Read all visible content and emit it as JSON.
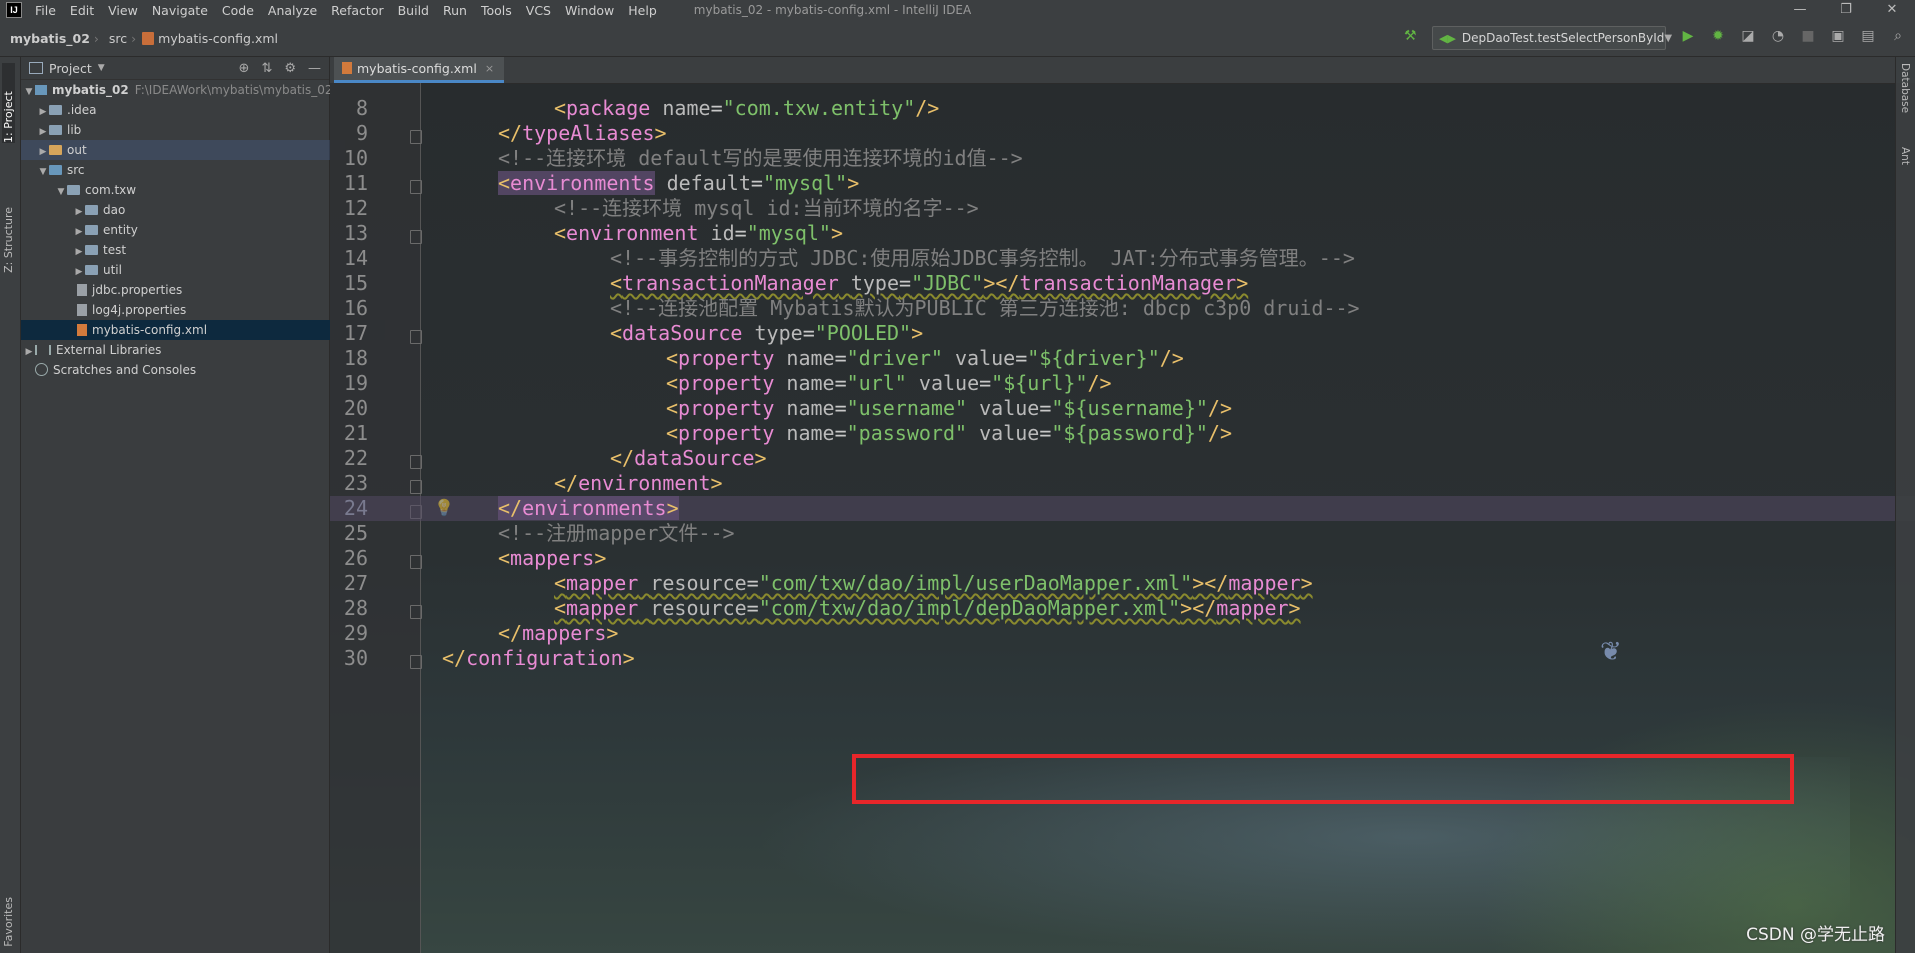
{
  "menubar": {
    "logo": "IJ",
    "items": [
      "File",
      "Edit",
      "View",
      "Navigate",
      "Code",
      "Analyze",
      "Refactor",
      "Build",
      "Run",
      "Tools",
      "VCS",
      "Window",
      "Help"
    ],
    "title": "mybatis_02 - mybatis-config.xml - IntelliJ IDEA",
    "controls": [
      "—",
      "❐",
      "✕"
    ]
  },
  "navbar": {
    "crumbs": [
      "mybatis_02",
      "src",
      "mybatis-config.xml"
    ],
    "run_config": "DepDaoTest.testSelectPersonById"
  },
  "left_strip": {
    "project_tab": "1: Project",
    "structure_tab": "Z: Structure",
    "favorites_tab": "Favorites"
  },
  "project_panel": {
    "title": "Project",
    "root": {
      "name": "mybatis_02",
      "path": "F:\\IDEAWork\\mybatis\\mybatis_02"
    },
    "items": [
      {
        "label": ".idea"
      },
      {
        "label": "lib"
      },
      {
        "label": "out"
      },
      {
        "label": "src"
      },
      {
        "label": "com.txw"
      },
      {
        "label": "dao"
      },
      {
        "label": "entity"
      },
      {
        "label": "test"
      },
      {
        "label": "util"
      },
      {
        "label": "jdbc.properties"
      },
      {
        "label": "log4j.properties"
      },
      {
        "label": "mybatis-config.xml"
      },
      {
        "label": "External Libraries"
      },
      {
        "label": "Scratches and Consoles"
      }
    ]
  },
  "editor": {
    "tab": "mybatis-config.xml",
    "line_numbers": [
      "8",
      "9",
      "10",
      "11",
      "12",
      "13",
      "14",
      "15",
      "16",
      "17",
      "18",
      "19",
      "20",
      "21",
      "22",
      "23",
      "24",
      "25",
      "26",
      "27",
      "28",
      "29",
      "30"
    ],
    "code": {
      "l8_tag": "package",
      "l8_attr": "name",
      "l8_val": "\"com.txw.entity\"",
      "l9_tag": "typeAliases",
      "l10_comment": "<!--连接环境 default写的是要使用连接环境的id值-->",
      "l11_tag": "environments",
      "l11_attr": "default",
      "l11_val": "\"mysql\"",
      "l12_comment": "<!--连接环境 mysql id:当前环境的名字-->",
      "l13_tag": "environment",
      "l13_attr": "id",
      "l13_val": "\"mysql\"",
      "l14_comment": "<!--事务控制的方式 JDBC:使用原始JDBC事务控制。 JAT:分布式事务管理。-->",
      "l15_tag": "transactionManager",
      "l15_attr": "type",
      "l15_val": "\"JDBC\"",
      "l16_comment": "<!--连接池配置 Mybatis默认为PUBLIC 第三方连接池: dbcp c3p0 druid-->",
      "l17_tag": "dataSource",
      "l17_attr": "type",
      "l17_val": "\"POOLED\"",
      "prop_tag": "property",
      "name_attr": "name",
      "value_attr": "value",
      "l18_name": "\"driver\"",
      "l18_value": "\"${driver}\"",
      "l19_name": "\"url\"",
      "l19_value": "\"${url}\"",
      "l20_name": "\"username\"",
      "l20_value": "\"${username}\"",
      "l21_name": "\"password\"",
      "l21_value": "\"${password}\"",
      "l22_tag": "dataSource",
      "l23_tag": "environment",
      "l24_tag": "environments",
      "l25_comment": "<!--注册mapper文件-->",
      "l26_tag": "mappers",
      "mapper_tag": "mapper",
      "resource_attr": "resource",
      "l27_val": "\"com/txw/dao/impl/userDaoMapper.xml\"",
      "l28_val": "\"com/txw/dao/impl/depDaoMapper.xml\"",
      "l29_tag": "mappers",
      "l30_tag": "configuration"
    }
  },
  "right_strip": {
    "database_tab": "Database",
    "ant_tab": "Ant"
  },
  "ime": {
    "logo": "S",
    "items": [
      "中",
      "°,",
      "🎤",
      "⌨",
      "▦"
    ]
  },
  "watermark": "CSDN @学无止路",
  "colors": {
    "highlight_box": "#e8262a",
    "selection": "#0d293e",
    "accent": "#4a88c7"
  }
}
